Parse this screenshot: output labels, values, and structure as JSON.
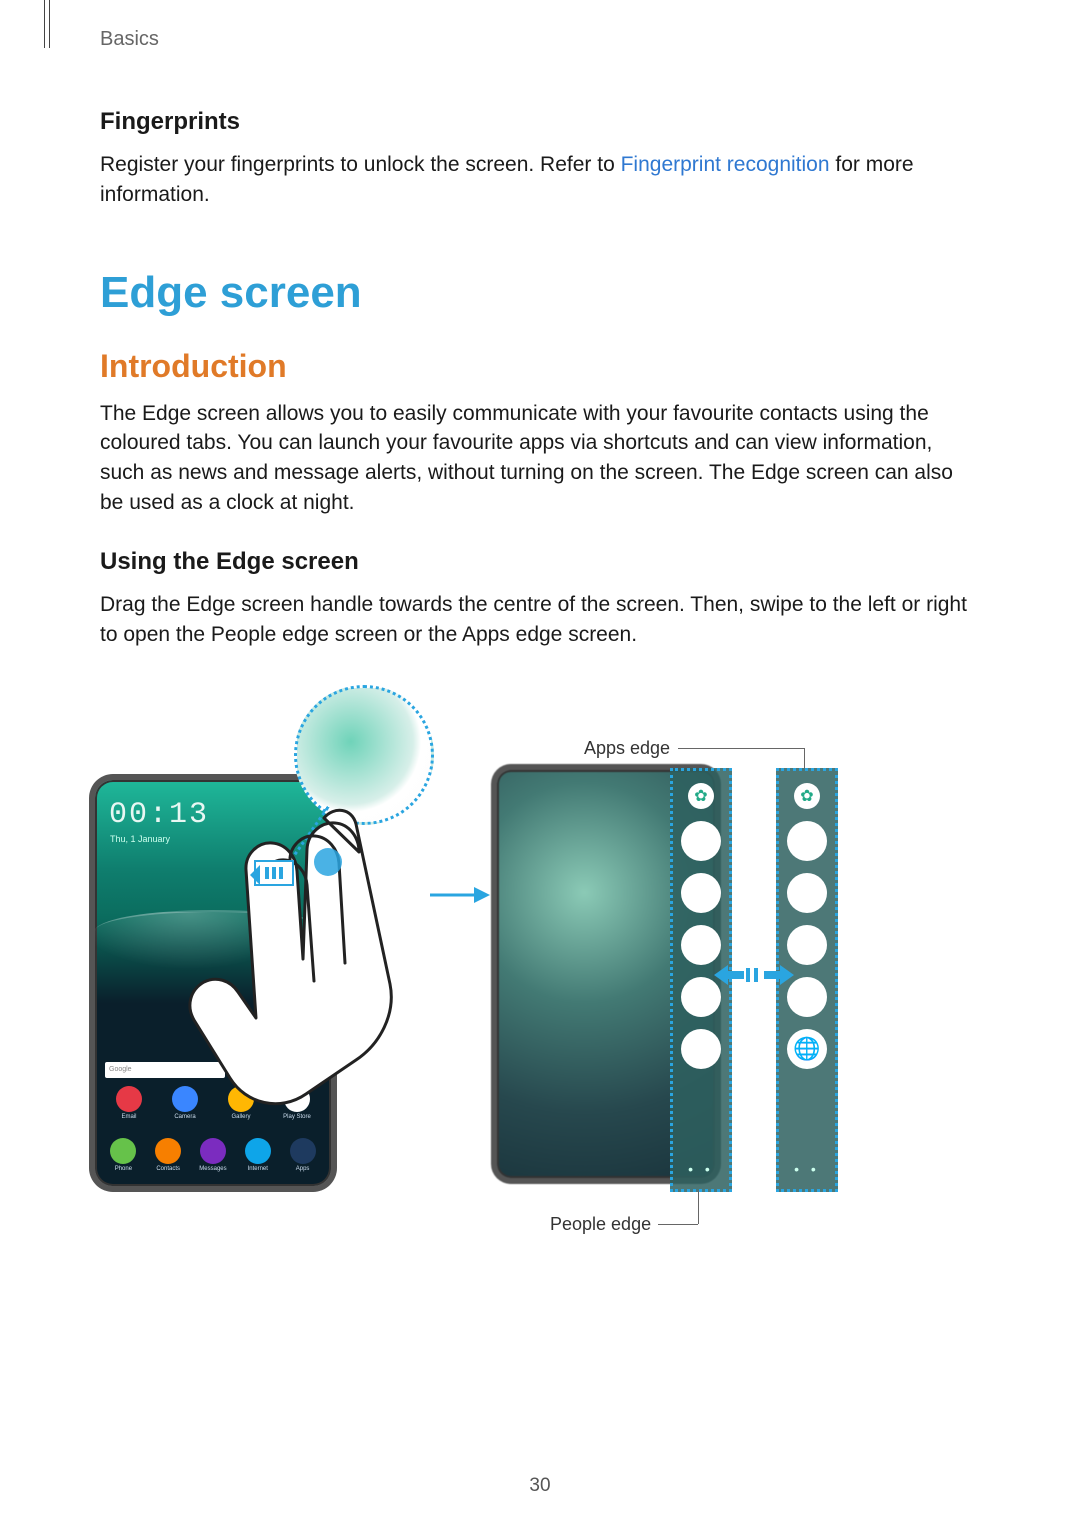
{
  "header": "Basics",
  "page_number": "30",
  "fingerprints": {
    "heading": "Fingerprints",
    "text_before_link": "Register your fingerprints to unlock the screen. Refer to ",
    "link": "Fingerprint recognition",
    "text_after_link": " for more information."
  },
  "edge_screen": {
    "heading": "Edge screen",
    "intro_heading": "Introduction",
    "intro_text": "The Edge screen allows you to easily communicate with your favourite contacts using the coloured tabs. You can launch your favourite apps via shortcuts and can view information, such as news and message alerts, without turning on the screen. The Edge screen can also be used as a clock at night.",
    "using_heading": "Using the Edge screen",
    "using_text": "Drag the Edge screen handle towards the centre of the screen. Then, swipe to the left or right to open the People edge screen or the Apps edge screen."
  },
  "figure": {
    "clock_time": "00:13",
    "clock_date": "Thu, 1 January",
    "search_placeholder": "Google",
    "dock_row1": [
      {
        "label": "Email",
        "cls": "c-email"
      },
      {
        "label": "Camera",
        "cls": "c-camera"
      },
      {
        "label": "Gallery",
        "cls": "c-gallery"
      },
      {
        "label": "Play Store",
        "cls": "c-play"
      }
    ],
    "dock_row2": [
      {
        "label": "Phone",
        "cls": "c-phone"
      },
      {
        "label": "Contacts",
        "cls": "c-contacts"
      },
      {
        "label": "Messages",
        "cls": "c-msg"
      },
      {
        "label": "Internet",
        "cls": "c-internet"
      },
      {
        "label": "Apps",
        "cls": "c-apps"
      }
    ],
    "label_apps_edge": "Apps edge",
    "label_people_edge": "People edge"
  }
}
